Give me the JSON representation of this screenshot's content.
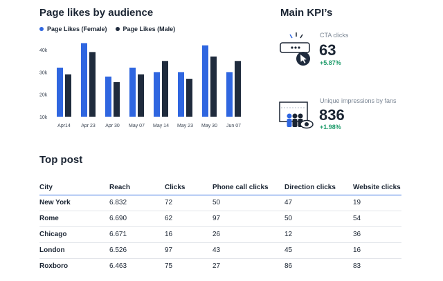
{
  "chart_title": "Page likes by audience",
  "colors": {
    "female": "#2f66e0",
    "male": "#1f2b3d",
    "positive": "#1f9c6b",
    "divider": "#2f6de1"
  },
  "chart_data": {
    "type": "bar",
    "categories": [
      "Apr14",
      "Apr 23",
      "Apr 30",
      "May 07",
      "May 14",
      "May 23",
      "May 30",
      "Jun 07"
    ],
    "series": [
      {
        "name": "Page Likes (Female)",
        "values": [
          32,
          43,
          28,
          32,
          30,
          30,
          42,
          30
        ]
      },
      {
        "name": "Page Likes (Male)",
        "values": [
          29,
          39,
          25.5,
          29,
          35,
          27,
          37,
          35
        ]
      }
    ],
    "yticks": [
      "10k",
      "20k",
      "30k",
      "40k"
    ],
    "ylim": [
      10,
      45
    ],
    "ytick_values": [
      10,
      20,
      30,
      40
    ],
    "grid": false,
    "legend": "top-left"
  },
  "kpi": {
    "title": "Main KPI’s",
    "items": [
      {
        "label": "CTA clicks",
        "value": "63",
        "change": "+5.87%",
        "icon": "cursor-click-icon"
      },
      {
        "label": "Unique impressions by fans",
        "value": "836",
        "change": "+1.98%",
        "icon": "audience-eye-icon"
      }
    ]
  },
  "top_post": {
    "title": "Top post",
    "columns": [
      "City",
      "Reach",
      "Clicks",
      "Phone call clicks",
      "Direction clicks",
      "Website clicks"
    ],
    "rows": [
      [
        "New York",
        "6.832",
        "72",
        "50",
        "47",
        "19"
      ],
      [
        "Rome",
        "6.690",
        "62",
        "97",
        "50",
        "54"
      ],
      [
        "Chicago",
        "6.671",
        "16",
        "26",
        "12",
        "36"
      ],
      [
        "London",
        "6.526",
        "97",
        "43",
        "45",
        "16"
      ],
      [
        "Roxboro",
        "6.463",
        "75",
        "27",
        "86",
        "83"
      ]
    ]
  }
}
